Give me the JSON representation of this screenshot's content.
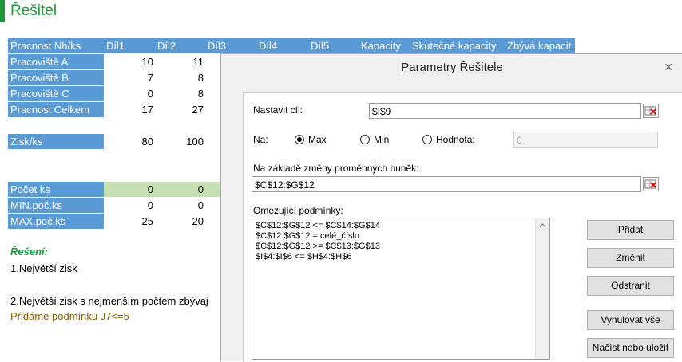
{
  "sheet": {
    "title": "Řešitel",
    "header": [
      "Pracnost Nh/ks",
      "Díl1",
      "Díl2",
      "Díl3",
      "Díl4",
      "Díl5",
      "Kapacity",
      "Skutečné kapacity",
      "Zbývá kapacit"
    ],
    "rows": [
      {
        "label": "Pracoviště A",
        "v1": "10",
        "v2": "11"
      },
      {
        "label": "Pracoviště B",
        "v1": "7",
        "v2": "8"
      },
      {
        "label": "Pracoviště C",
        "v1": "0",
        "v2": "8"
      },
      {
        "label": "Pracnost Celkem",
        "v1": "17",
        "v2": "27"
      },
      {
        "label": "Zisk/ks",
        "v1": "80",
        "v2": "100"
      },
      {
        "label": "Počet ks",
        "v1": "0",
        "v2": "0"
      },
      {
        "label": "MIN.poč.ks",
        "v1": "0",
        "v2": "0"
      },
      {
        "label": "MAX.poč.ks",
        "v1": "25",
        "v2": "20"
      }
    ],
    "notes": {
      "solution_label": "Řešení:",
      "item1": "1.Největší zisk",
      "item2": "2.Největší zisk s nejmenším počtem zbývaj",
      "item3": "Přidáme podmínku J7<=5"
    },
    "colors": {
      "header_bg": "#5b9bd5",
      "green_row": "#c6e0b4",
      "title_green": "#1a9a3a",
      "note_brown": "#806000"
    }
  },
  "dialog": {
    "title": "Parametry Řešitele",
    "close_glyph": "✕",
    "objective_label": "Nastavit cíl:",
    "objective_value": "$I$9",
    "to_label": "Na:",
    "opt_max": "Max",
    "opt_min": "Min",
    "opt_value": "Hodnota:",
    "value_field": "0",
    "selected_option": "Max",
    "changing_label": "Na základě změny proměnných buněk:",
    "changing_value": "$C$12:$G$12",
    "constraints_label": "Omezující podmínky:",
    "constraints": [
      "$C$12:$G$12 <= $C$14:$G$14",
      "$C$12:$G$12 = celé_číslo",
      "$C$12:$G$12 >= $C$13:$G$13",
      "$I$4:$I$6 <= $H$4:$H$6"
    ],
    "buttons": {
      "add": "Přidat",
      "change": "Změnit",
      "delete": "Odstranit",
      "reset": "Vynulovat vše",
      "load_save": "Načíst nebo uložit"
    }
  }
}
